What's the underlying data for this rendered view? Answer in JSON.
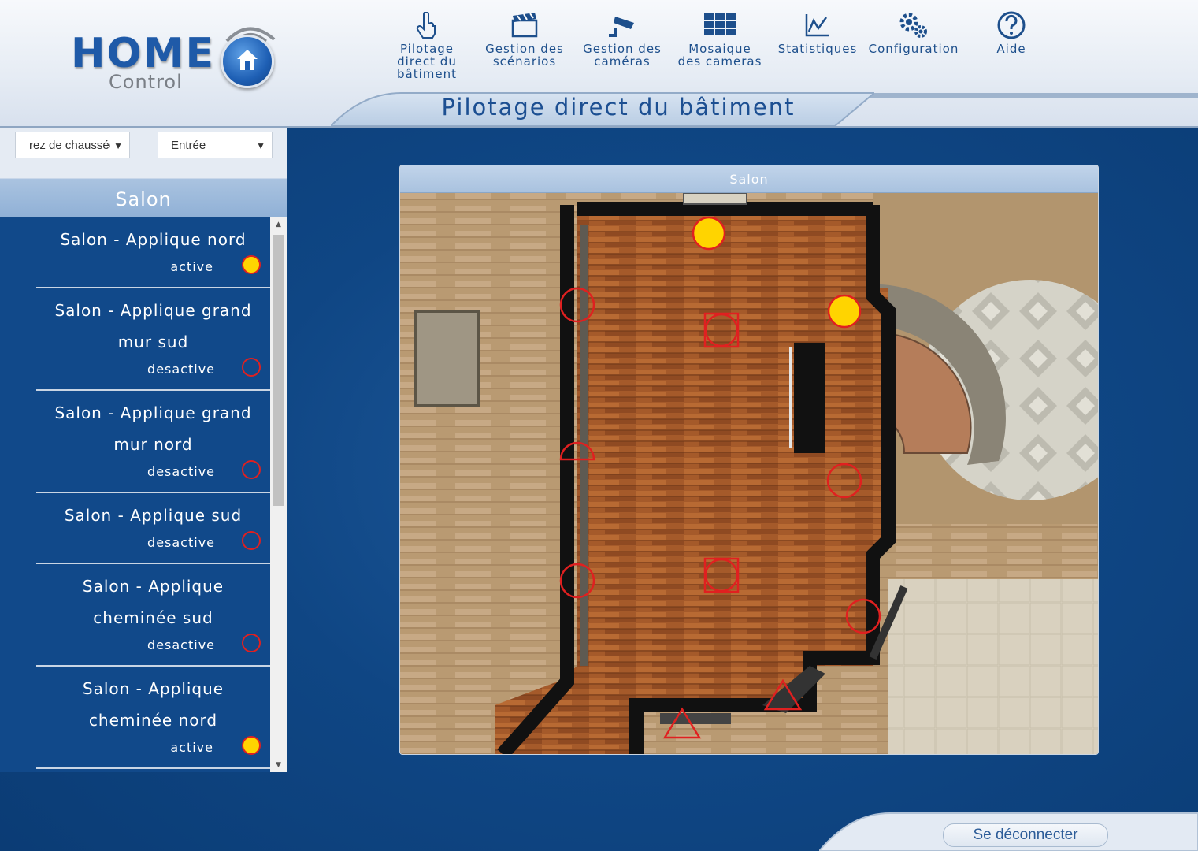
{
  "nav": [
    {
      "label": "Pilotage\ndirect du\nbâtiment",
      "icon": "hand-pointer-icon"
    },
    {
      "label": "Gestion des\nscénarios",
      "icon": "clapperboard-icon"
    },
    {
      "label": "Gestion des\ncaméras",
      "icon": "security-camera-icon"
    },
    {
      "label": "Mosaique\ndes cameras",
      "icon": "grid-icon"
    },
    {
      "label": "Statistiques",
      "icon": "chart-icon"
    },
    {
      "label": "Configuration",
      "icon": "gears-icon"
    },
    {
      "label": "Aide",
      "icon": "help-icon"
    }
  ],
  "logo": {
    "main": "HOME",
    "sub": "Control"
  },
  "page_title": "Pilotage direct du bâtiment",
  "selectors": {
    "floor": "rez de chaussée",
    "room": "Entrée"
  },
  "room_header": "Salon",
  "devices": [
    {
      "name": "Salon - Applique nord",
      "state": "active",
      "on": true
    },
    {
      "name": "Salon - Applique grand mur sud",
      "state": "desactive",
      "on": false
    },
    {
      "name": "Salon - Applique grand mur nord",
      "state": "desactive",
      "on": false
    },
    {
      "name": "Salon - Applique sud",
      "state": "desactive",
      "on": false
    },
    {
      "name": "Salon - Applique cheminée sud",
      "state": "desactive",
      "on": false
    },
    {
      "name": "Salon - Applique cheminée nord",
      "state": "active",
      "on": true
    }
  ],
  "plan": {
    "title": "Salon"
  },
  "footer": {
    "logout": "Se déconnecter"
  },
  "colors": {
    "accent": "#1d4f8c",
    "lamp_on": "#ffd400",
    "lamp_ring": "#e02020",
    "panel": "#11498a"
  }
}
